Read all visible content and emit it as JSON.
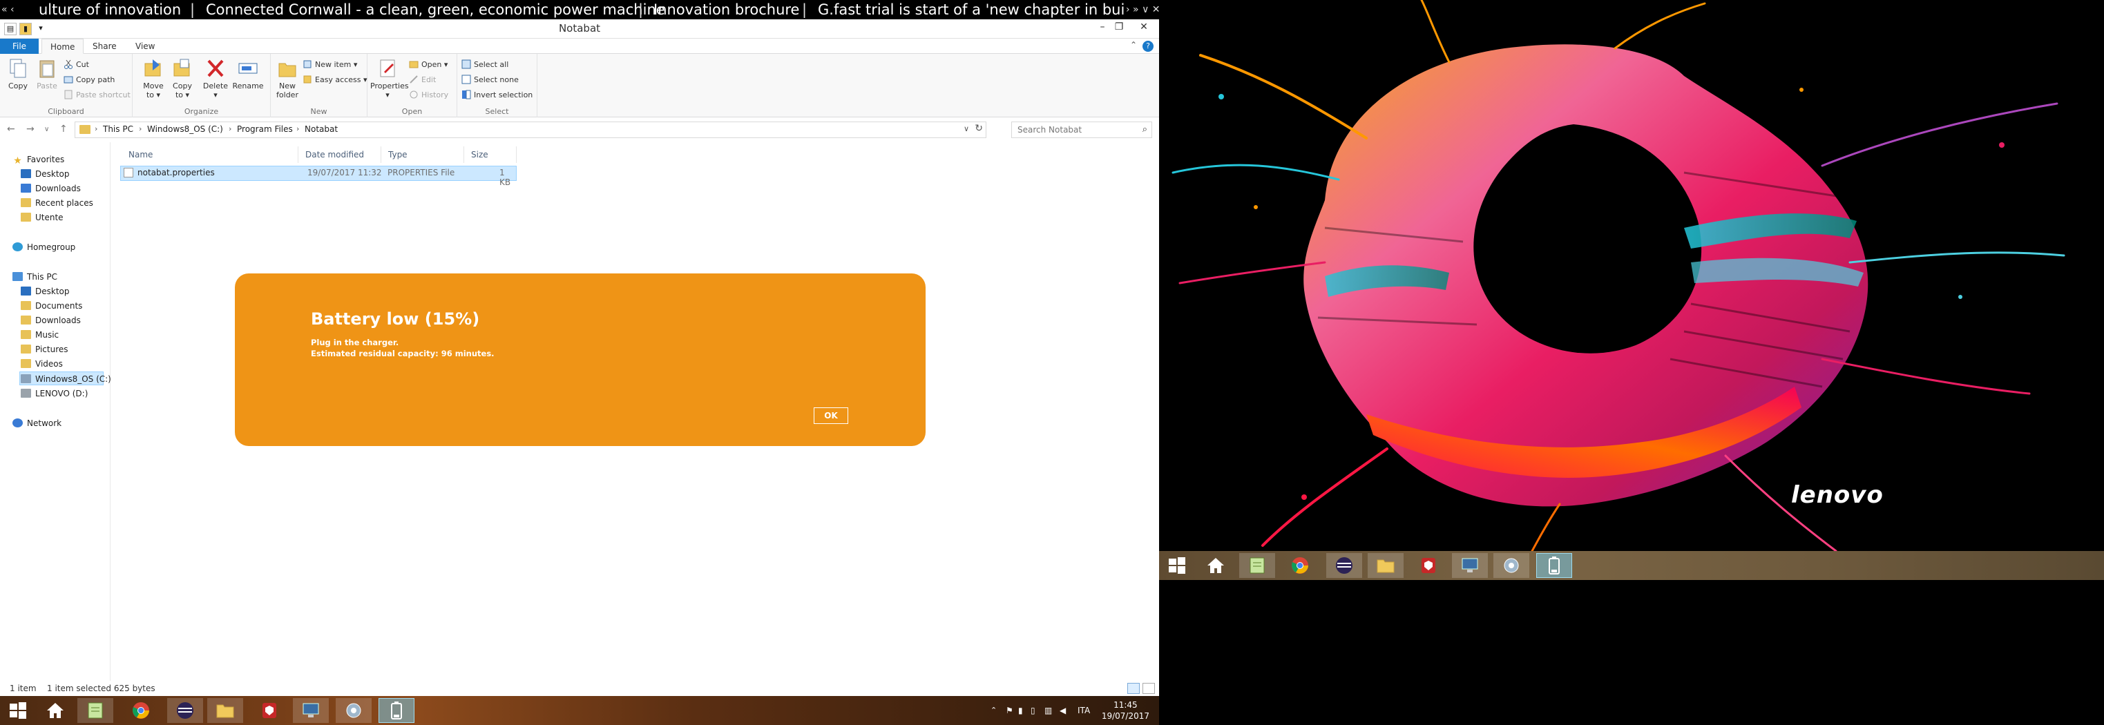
{
  "ticker": {
    "items": [
      "ulture of innovation",
      "Connected Cornwall - a clean, green, economic power machine",
      "Innovation brochure",
      "G.fast trial is start of a 'new chapter in buildi"
    ],
    "controls_left": [
      "«",
      "‹"
    ],
    "controls_right": [
      "›",
      "»",
      "∨",
      "✕"
    ]
  },
  "explorer": {
    "title": "Notabat",
    "tabs": [
      "File",
      "Home",
      "Share",
      "View"
    ],
    "ribbon": {
      "clipboard": {
        "label": "Clipboard",
        "copy": "Copy",
        "paste": "Paste",
        "cut": "Cut",
        "copy_path": "Copy path",
        "paste_shortcut": "Paste shortcut"
      },
      "organize": {
        "label": "Organize",
        "move_to_1": "Move",
        "move_to_2": "to ▾",
        "copy_to_1": "Copy",
        "copy_to_2": "to ▾",
        "delete_1": "Delete",
        "delete_2": "▾",
        "rename": "Rename"
      },
      "new": {
        "label": "New",
        "new_folder_1": "New",
        "new_folder_2": "folder",
        "new_item": "New item ▾",
        "easy_access": "Easy access ▾"
      },
      "open": {
        "label": "Open",
        "properties": "Properties",
        "properties_dd": "▾",
        "open": "Open ▾",
        "edit": "Edit",
        "history": "History"
      },
      "select": {
        "label": "Select",
        "select_all": "Select all",
        "select_none": "Select none",
        "invert": "Invert selection"
      }
    },
    "breadcrumb": [
      "This PC",
      "Windows8_OS (C:)",
      "Program Files",
      "Notabat"
    ],
    "search_placeholder": "Search Notabat",
    "nav": {
      "favorites": "Favorites",
      "desktop": "Desktop",
      "downloads": "Downloads",
      "recent": "Recent places",
      "utente": "Utente",
      "homegroup": "Homegroup",
      "this_pc": "This PC",
      "pc_desktop": "Desktop",
      "documents": "Documents",
      "pc_downloads": "Downloads",
      "music": "Music",
      "pictures": "Pictures",
      "videos": "Videos",
      "windows_os": "Windows8_OS (C:)",
      "lenovo_d": "LENOVO (D:)",
      "network": "Network"
    },
    "columns": [
      "Name",
      "Date modified",
      "Type",
      "Size"
    ],
    "files": [
      {
        "name": "notabat.properties",
        "date": "19/07/2017 11:32",
        "type": "PROPERTIES File",
        "size": "1 KB"
      }
    ],
    "status": {
      "count": "1 item",
      "selected": "1 item selected  625 bytes"
    }
  },
  "battery_dialog": {
    "title": "Battery low (15%)",
    "line1": "Plug in the charger.",
    "line2": "Estimated residual capacity: 96 minutes.",
    "ok": "OK",
    "battery_level": 0.15,
    "color": "#ef9416"
  },
  "taskbar_left": {
    "items": [
      "start-icon",
      "home-icon",
      "notepad-icon",
      "chrome-icon",
      "eclipse-icon",
      "file-explorer-icon",
      "security-icon",
      "computer-icon",
      "control-panel-icon",
      "battery-app-icon"
    ],
    "tray": {
      "lang": "ITA",
      "time": "11:45",
      "date": "19/07/2017"
    }
  },
  "right_screen": {
    "brand": "lenovo",
    "taskbar_items": [
      "start-icon",
      "home-icon",
      "notepad-icon",
      "chrome-icon",
      "eclipse-icon",
      "file-explorer-icon",
      "security-icon",
      "computer-icon",
      "control-panel-icon",
      "battery-app-icon"
    ]
  },
  "colors": {
    "accent": "#1979ca",
    "selection": "#cce8ff",
    "battery_orange": "#ef9416"
  }
}
